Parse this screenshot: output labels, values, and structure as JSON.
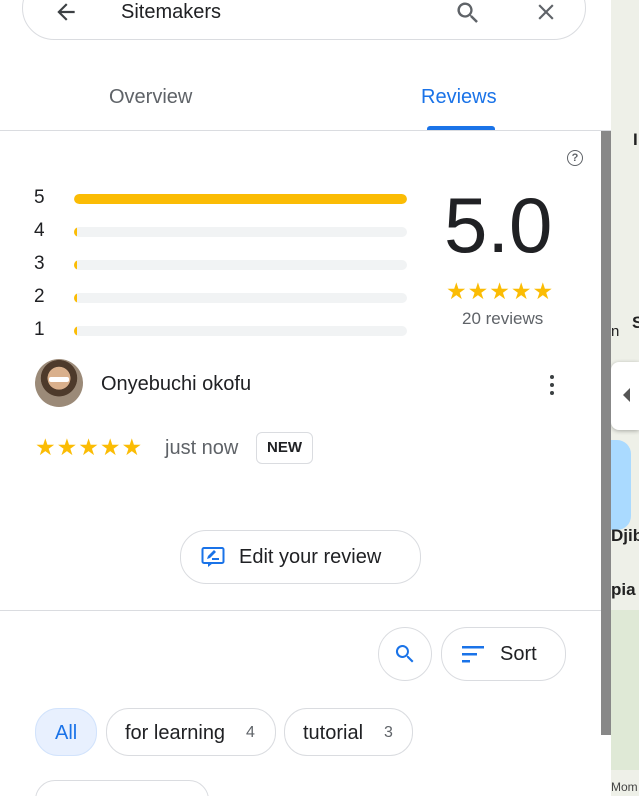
{
  "search": {
    "query": "Sitemakers"
  },
  "tabs": [
    {
      "label": "Overview"
    },
    {
      "label": "Reviews"
    }
  ],
  "rating_summary": {
    "average": "5.0",
    "review_count_text": "20 reviews",
    "histogram": [
      {
        "stars": "5",
        "fraction": 1.0
      },
      {
        "stars": "4",
        "fraction": 0.0
      },
      {
        "stars": "3",
        "fraction": 0.0
      },
      {
        "stars": "2",
        "fraction": 0.0
      },
      {
        "stars": "1",
        "fraction": 0.0
      }
    ],
    "stars": "★★★★★"
  },
  "review": {
    "author": "Onyebuchi okofu",
    "stars": "★★★★★",
    "time": "just now",
    "badge": "NEW"
  },
  "actions": {
    "edit_review": "Edit your review",
    "sort": "Sort"
  },
  "filters": [
    {
      "label": "All",
      "count": ""
    },
    {
      "label": "for learning",
      "count": "4"
    },
    {
      "label": "tutorial",
      "count": "3"
    }
  ],
  "map_labels": {
    "label1": "I",
    "label2": "S",
    "label3": "n",
    "label4": "Djib",
    "label5": "pia",
    "label6": "Mom"
  },
  "colors": {
    "accent": "#1a73e8",
    "star": "#fbbc04"
  }
}
